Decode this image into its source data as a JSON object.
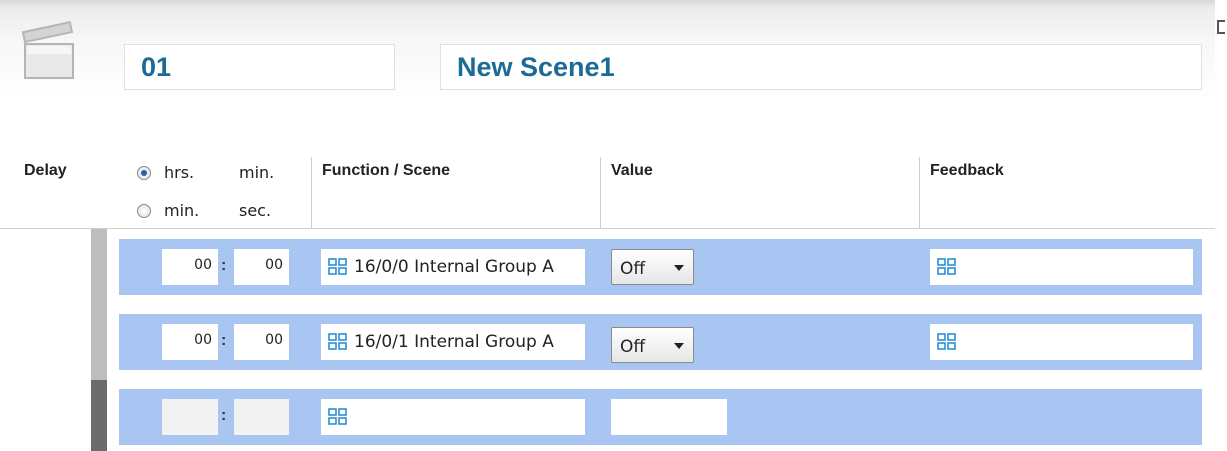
{
  "header": {
    "scene_number": "01",
    "scene_name": "New Scene1"
  },
  "columns": {
    "delay": "Delay",
    "function_scene": "Function / Scene",
    "value": "Value",
    "feedback": "Feedback"
  },
  "delay_mode": {
    "options": [
      {
        "label_1": "hrs.",
        "label_2": "min.",
        "selected": true
      },
      {
        "label_1": "min.",
        "label_2": "sec.",
        "selected": false
      }
    ]
  },
  "rows": [
    {
      "time_1": "00",
      "time_2": "00",
      "separator": ":",
      "function": "16/0/0 Internal Group A",
      "value": "Off",
      "feedback": ""
    },
    {
      "time_1": "00",
      "time_2": "00",
      "separator": ":",
      "function": "16/0/1 Internal Group A",
      "value": "Off",
      "feedback": ""
    },
    {
      "time_1": "",
      "time_2": "",
      "separator": ":",
      "function": "",
      "value": "",
      "feedback": null
    }
  ],
  "colors": {
    "row_background": "#a9c6f2",
    "header_text": "#1c6a96",
    "group_icon": "#2a8fd6"
  },
  "icons": {
    "scene": "clapperboard-icon",
    "group_address": "group-address-icon"
  }
}
